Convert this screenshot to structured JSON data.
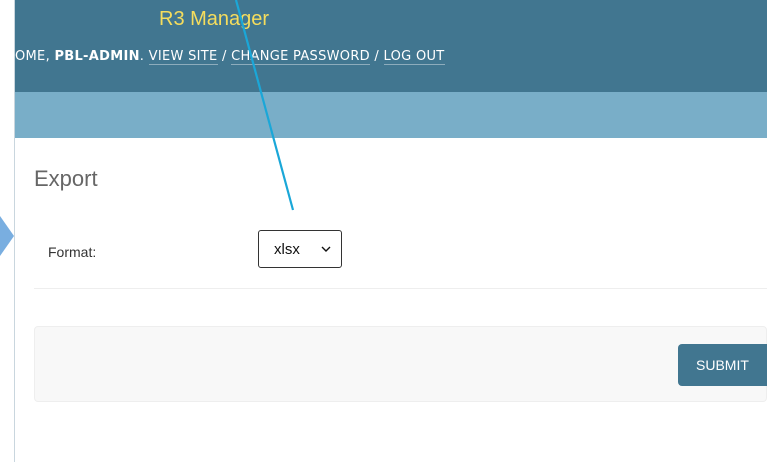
{
  "header": {
    "site_title": "R3 Manager",
    "welcome_prefix": "OME, ",
    "username": "PBL-ADMIN",
    "welcome_suffix": ". ",
    "view_site": "VIEW SITE",
    "sep1": " / ",
    "change_password": "CHANGE PASSWORD",
    "sep2": " / ",
    "log_out": "LOG OUT"
  },
  "content": {
    "title": "Export",
    "format_label": "Format:",
    "format_value": "xlsx",
    "submit_label": "SUBMIT"
  },
  "colors": {
    "header_bg": "#417690",
    "subbar_bg": "#79aec8",
    "branding_text": "#f5dd5d",
    "button_bg": "#417690",
    "annotation_arrow": "#1aa7d8"
  },
  "icons": {
    "select_caret": "chevron-down-icon",
    "left_marker": "arrow-right-icon"
  }
}
